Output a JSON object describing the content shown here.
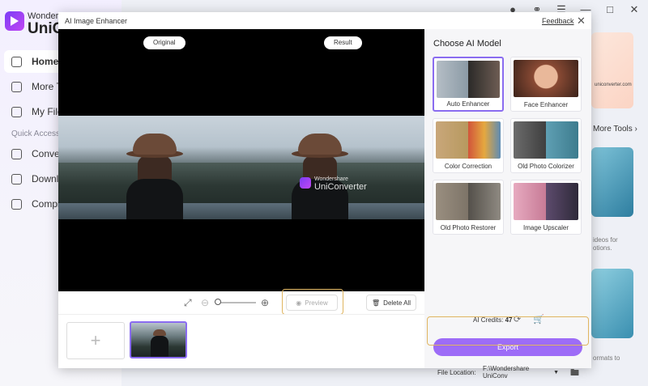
{
  "app": {
    "brand_top": "Wonders",
    "brand_main": "UniCo",
    "nav": [
      {
        "label": "Home"
      },
      {
        "label": "More Too"
      },
      {
        "label": "My Files"
      }
    ],
    "quick_access_label": "Quick Access",
    "quick": [
      {
        "label": "Converte"
      },
      {
        "label": "Downloa"
      },
      {
        "label": "Compres"
      }
    ],
    "more_tools": "More Tools",
    "side_text_1": "ideos for",
    "side_text_2": "otions.",
    "side_text_3": "ormats to",
    "banner_url": "uniconverter.com"
  },
  "dialog": {
    "title": "AI Image Enhancer",
    "feedback": "Feedback",
    "original_label": "Original",
    "result_label": "Result",
    "watermark_top": "Wondershare",
    "watermark_main": "UniConverter",
    "preview_label": "Preview",
    "delete_all_label": "Delete All",
    "panel_title": "Choose AI Model",
    "models": [
      {
        "label": "Auto Enhancer"
      },
      {
        "label": "Face Enhancer"
      },
      {
        "label": "Color Correction"
      },
      {
        "label": "Old Photo Colorizer"
      },
      {
        "label": "Old Photo Restorer"
      },
      {
        "label": "Image Upscaler"
      }
    ],
    "credits_label": "AI Credits:",
    "credits_value": "47",
    "export_label": "Export",
    "file_location_label": "File Location:",
    "file_location_value": "F:\\Wondershare UniConv"
  }
}
